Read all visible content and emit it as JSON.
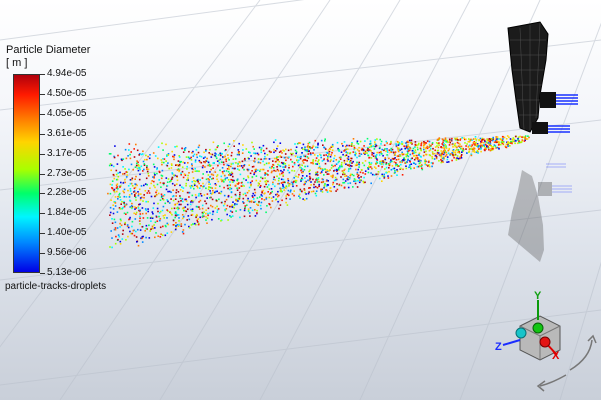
{
  "legend": {
    "title_line1": "Particle Diameter",
    "title_line2": "[ m ]",
    "ticks": [
      "4.94e-05",
      "4.50e-05",
      "4.05e-05",
      "3.61e-05",
      "3.17e-05",
      "2.73e-05",
      "2.28e-05",
      "1.84e-05",
      "1.40e-05",
      "9.56e-06",
      "5.13e-06"
    ],
    "object_name": "particle-tracks-droplets",
    "colormap": [
      "#0000e6",
      "#0088ff",
      "#00f5ff",
      "#00ff6a",
      "#a8ff00",
      "#ffd400",
      "#ff7a00",
      "#ff1a00",
      "#b0000d"
    ]
  },
  "triad": {
    "x": "X",
    "y": "Y",
    "z": "Z"
  },
  "icons": [
    "nozzle-geometry-icon",
    "rotate-arrow-icon",
    "axis-triad-icon"
  ]
}
